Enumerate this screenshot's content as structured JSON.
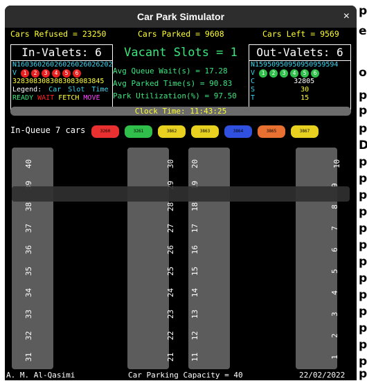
{
  "window": {
    "title": "Car Park Simulator",
    "close": "×"
  },
  "stats": {
    "refused": "Cars Refused = 23250",
    "parked": "Cars Parked = 9608",
    "left": "Cars Left = 9569"
  },
  "in_valets": {
    "header": "In-Valets: 6",
    "row_n": "N16036026026026026026202",
    "row_v": "V",
    "numbers": [
      "1",
      "2",
      "3",
      "4",
      "5",
      "6"
    ],
    "row_3": "3283083083083083083845",
    "legend_label": "Legend:",
    "legend_items": [
      "Car",
      "Slot",
      "Time"
    ],
    "legend_states": [
      "READY",
      "WAIT",
      "FETCH",
      "MOVE"
    ]
  },
  "out_valets": {
    "header": "Out-Valets: 6",
    "row_n": "N15950950950950959594",
    "row_v": "V",
    "numbers": [
      "1",
      "2",
      "3",
      "4",
      "5",
      "6"
    ],
    "row_c_label": "C",
    "row_c": "32805",
    "row_s_label": "S",
    "row_s": "30",
    "row_t_label": "T",
    "row_t": "15"
  },
  "center": {
    "vacant": "Vacant Slots = 1",
    "queue_wait": "Avg Queue Wait(s) =  17.28",
    "parked_time": "Avg Parked Time(s) =  90.83",
    "utilization": "Park Utilization(%) =  97.50"
  },
  "clock": "Clock Time: 11:43:25",
  "queue": {
    "label": "In-Queue 7 cars",
    "cars": [
      "3260",
      "3261",
      "3862",
      "3863",
      "3864",
      "3865",
      "3867"
    ]
  },
  "slots": {
    "left_outer": [
      "40",
      "39",
      "38",
      "37",
      "36",
      "35",
      "34",
      "33",
      "32",
      "31"
    ],
    "left_inner": [
      "30",
      "29",
      "28",
      "27",
      "26",
      "25",
      "24",
      "23",
      "22",
      "21"
    ],
    "right_inner": [
      "20",
      "19",
      "18",
      "17",
      "16",
      "15",
      "14",
      "13",
      "12",
      "11"
    ],
    "right_outer": [
      "10",
      "9",
      "8",
      "7",
      "6",
      "5",
      "4",
      "3",
      "2",
      "1"
    ]
  },
  "footer": {
    "author": "A. M. Al-Qasimi",
    "capacity": "Car Parking Capacity = 40",
    "date": "22/02/2022"
  },
  "colors": {
    "yellow": "#ffff33",
    "green": "#3ce67e",
    "red": "#ff2222",
    "cyan": "#3bd6f0",
    "magenta": "#ff44ff"
  },
  "background_letters": [
    "e",
    "o",
    "p",
    "p",
    "p",
    "D",
    "p",
    "p",
    "p",
    "p",
    "p",
    "p",
    "p",
    "p",
    "p",
    "p",
    "p",
    "p",
    "p",
    "p",
    "p"
  ]
}
